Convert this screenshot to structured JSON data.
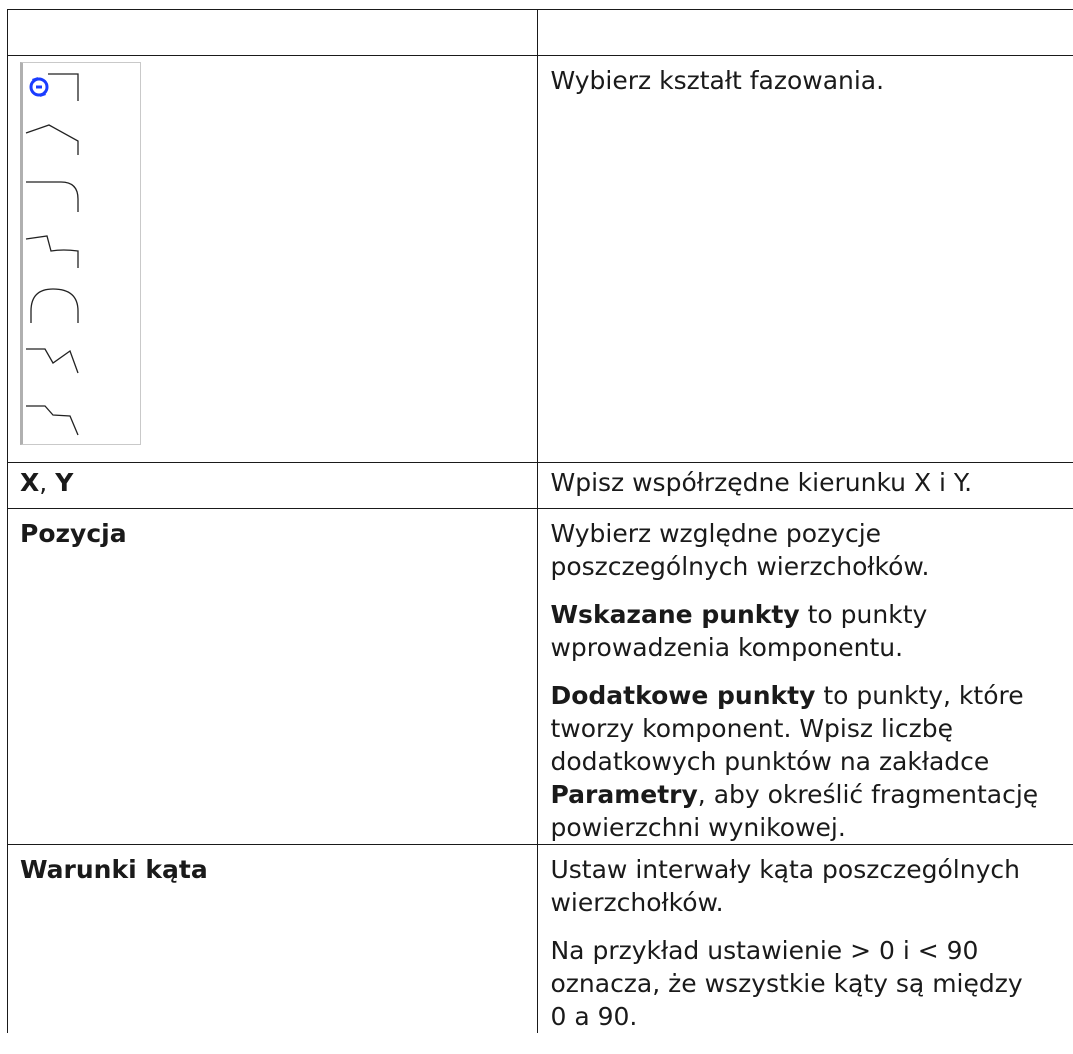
{
  "rows": {
    "shape": {
      "description": "Wybierz kształt fazowania.",
      "icons": [
        "auto-default-icon",
        "chamfer-line-icon",
        "chamfer-rounded-icon",
        "chamfer-convex-icon",
        "chamfer-arc-icon",
        "chamfer-zigzag-icon",
        "chamfer-step-icon"
      ]
    },
    "xy": {
      "label_x": "X",
      "label_sep": ", ",
      "label_y": "Y",
      "description": "Wpisz współrzędne kierunku X i Y."
    },
    "position": {
      "label": "Pozycja",
      "p1_line1": "Wybierz względne pozycje",
      "p1_line2": "poszczególnych wierzchołków.",
      "p2_bold": "Wskazane punkty",
      "p2_line1_rest": " to punkty",
      "p2_line2": "wprowadzenia komponentu.",
      "p3_bold": "Dodatkowe punkty",
      "p3_line1_rest": " to punkty, które",
      "p3_line2": "tworzy komponent. Wpisz liczbę",
      "p3_line3": "dodatkowych punktów na zakładce",
      "p3_bold2": "Parametry",
      "p3_line4_rest": ", aby określić fragmentację",
      "p3_line5": "powierzchni wynikowej."
    },
    "angle": {
      "label": "Warunki kąta",
      "p1_line1": "Ustaw interwały kąta poszczególnych",
      "p1_line2": "wierzchołków.",
      "p2_line1": "Na przykład ustawienie > 0 i < 90",
      "p2_line2": "oznacza, że wszystkie kąty są między",
      "p2_line3": "0 a 90."
    }
  },
  "colors": {
    "border": "#1a1a1a",
    "icon_blue": "#1a3cff",
    "panel_border": "#c9c9c9"
  }
}
